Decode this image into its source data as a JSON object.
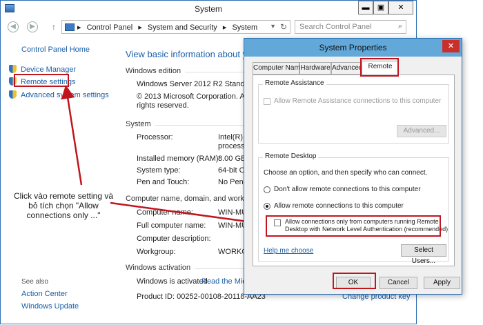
{
  "window": {
    "title": "System",
    "minimize": "▬",
    "maximize": "▣",
    "close": "✕"
  },
  "address": {
    "back": "◀",
    "forward": "▶",
    "up": "↑",
    "crumbs": [
      "Control Panel",
      "System and Security",
      "System"
    ],
    "search_placeholder": "Search Control Panel"
  },
  "left": {
    "home": "Control Panel Home",
    "links": [
      "Device Manager",
      "Remote settings",
      "Advanced system settings"
    ],
    "see_also": "See also",
    "see_also_links": [
      "Action Center",
      "Windows Update"
    ]
  },
  "main": {
    "heading": "View basic information about y",
    "edition_section": "Windows edition",
    "edition": "Windows Server 2012 R2 Standard",
    "copyright_line1": "© 2013 Microsoft Corporation. All",
    "copyright_line2": "rights reserved.",
    "system_section": "System",
    "rows": [
      {
        "label": "Processor:",
        "value": "Intel(R) X",
        "value2": "processo"
      },
      {
        "label": "Installed memory (RAM):",
        "value": "8.00 GB"
      },
      {
        "label": "System type:",
        "value": "64-bit Op"
      },
      {
        "label": "Pen and Touch:",
        "value": "No Pen o"
      }
    ],
    "name_section": "Computer name, domain, and workgroup",
    "name_rows": [
      {
        "label": "Computer name:",
        "value": "WIN-MU"
      },
      {
        "label": "Full computer name:",
        "value": "WIN-MU"
      },
      {
        "label": "Computer description:",
        "value": ""
      },
      {
        "label": "Workgroup:",
        "value": "WORKGR"
      }
    ],
    "activation_section": "Windows activation",
    "activation_status": "Windows is activated",
    "activation_link": "Read the Micro",
    "product_id": "Product ID:  00252-00108-20118-AA23",
    "change_key": "Change product key"
  },
  "annotation": "Click vào remote setting và bỏ tích chọn \"Allow connections only ...\"",
  "dialog": {
    "title": "System Properties",
    "close": "✕",
    "tabs": [
      "Computer Name",
      "Hardware",
      "Advanced",
      "Remote"
    ],
    "remote_assistance": {
      "group": "Remote Assistance",
      "checkbox": "Allow Remote Assistance connections to this computer",
      "advanced": "Advanced..."
    },
    "remote_desktop": {
      "group": "Remote Desktop",
      "intro": "Choose an option, and then specify who can connect.",
      "opt1": "Don't allow remote connections to this computer",
      "opt2": "Allow remote connections to this computer",
      "nla_line1": "Allow connections only from computers running Remote",
      "nla_line2": "Desktop with Network Level Authentication (recommended)",
      "help": "Help me choose",
      "select_users": "Select Users..."
    },
    "buttons": {
      "ok": "OK",
      "cancel": "Cancel",
      "apply": "Apply"
    }
  },
  "colors": {
    "highlight": "#c0151d",
    "link": "#1a5fa8",
    "dialog_title": "#62a8d8"
  }
}
